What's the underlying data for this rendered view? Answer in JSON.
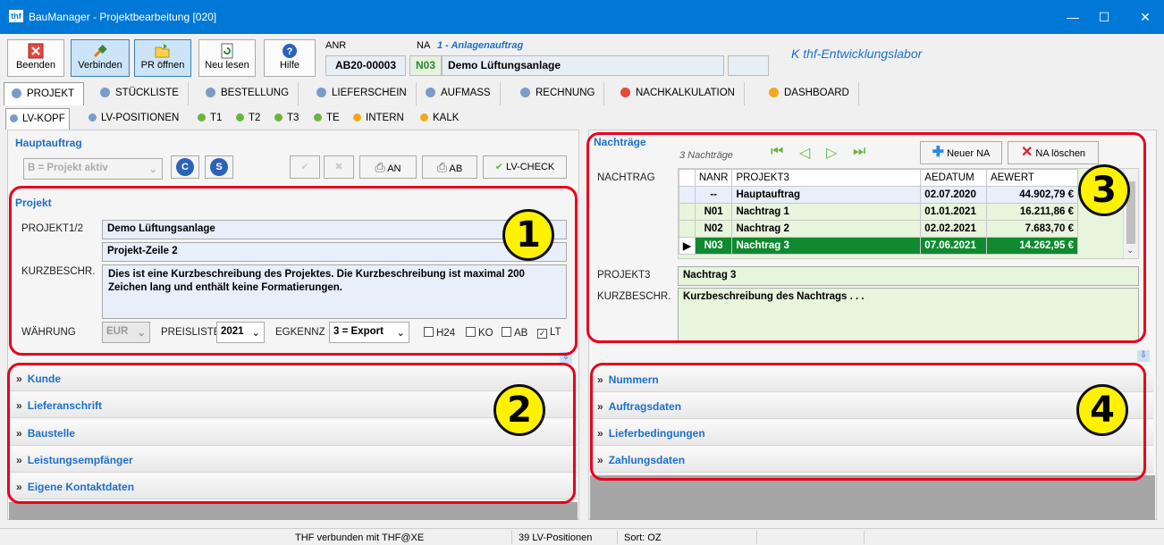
{
  "window": {
    "title": "BauManager - Projektbearbeitung [020]",
    "logo_text": "thf"
  },
  "toolbar": {
    "buttons": [
      {
        "label": "Beenden",
        "icon": "close-box-icon"
      },
      {
        "label": "Verbinden",
        "icon": "plug-icon"
      },
      {
        "label": "PR öffnen",
        "icon": "folder-open-icon"
      },
      {
        "label": "Neu lesen",
        "icon": "refresh-doc-icon"
      },
      {
        "label": "Hilfe",
        "icon": "help-icon"
      }
    ],
    "anr_label": "ANR",
    "anr_value": "AB20-00003",
    "na_label": "NA",
    "na_title": "1 - Anlagenauftrag",
    "na_code": "N03",
    "na_name": "Demo Lüftungsanlage",
    "company": "K thf-Entwicklungslabor"
  },
  "main_tabs": [
    {
      "label": "PROJEKT",
      "color": "#7a9cc8"
    },
    {
      "label": "STÜCKLISTE",
      "color": "#7a9cc8"
    },
    {
      "label": "BESTELLUNG",
      "color": "#7a9cc8"
    },
    {
      "label": "LIEFERSCHEIN",
      "color": "#7a9cc8"
    },
    {
      "label": "AUFMASS",
      "color": "#7a9cc8"
    },
    {
      "label": "RECHNUNG",
      "color": "#7a9cc8"
    },
    {
      "label": "NACHKALKULATION",
      "color": "#e24a3b"
    },
    {
      "label": "DASHBOARD",
      "color": "#f2a91d"
    }
  ],
  "sub_tabs": [
    {
      "label": "LV-KOPF",
      "color": "#7a9cc8"
    },
    {
      "label": "LV-POSITIONEN",
      "color": "#7a9cc8"
    },
    {
      "label": "T1",
      "color": "#6db33f"
    },
    {
      "label": "T2",
      "color": "#6db33f"
    },
    {
      "label": "T3",
      "color": "#6db33f"
    },
    {
      "label": "TE",
      "color": "#6db33f"
    },
    {
      "label": "INTERN",
      "color": "#f2a91d"
    },
    {
      "label": "KALK",
      "color": "#f2a91d"
    }
  ],
  "hauptauftrag": {
    "title": "Hauptauftrag",
    "status": "B = Projekt aktiv",
    "btn_c": "C",
    "btn_s": "S",
    "btn_an": "AN",
    "btn_ab": "AB",
    "btn_lvcheck": "LV-CHECK"
  },
  "projekt": {
    "title": "Projekt",
    "projekt12_label": "PROJEKT1/2",
    "projekt1": "Demo Lüftungsanlage",
    "projekt2": "Projekt-Zeile 2",
    "kurzbeschr_label": "KURZBESCHR.",
    "kurzbeschr": "Dies ist eine Kurzbeschreibung des Projektes. Die Kurzbeschreibung ist maximal 200 Zeichen lang und enthält keine Formatierungen.",
    "waehrung_label": "WÄHRUNG",
    "waehrung": "EUR",
    "preisliste_label": "PREISLISTE",
    "preisliste": "2021",
    "egkennz_label": "EGKENNZ",
    "egkennz": "3 = Export",
    "checks": [
      {
        "label": "H24",
        "checked": false
      },
      {
        "label": "KO",
        "checked": false
      },
      {
        "label": "AB",
        "checked": false
      },
      {
        "label": "LT",
        "checked": true
      }
    ]
  },
  "left_accordion": [
    "Kunde",
    "Lieferanschrift",
    "Baustelle",
    "Leistungsempfänger",
    "Eigene Kontaktdaten"
  ],
  "nachtraege": {
    "title": "Nachträge",
    "count_text": "3 Nachträge",
    "btn_new": "Neuer NA",
    "btn_delete": "NA löschen",
    "nachtrag_label": "NACHTRAG",
    "columns": [
      "NANR",
      "PROJEKT3",
      "AEDATUM",
      "AEWERT"
    ],
    "rows": [
      {
        "nanr": "--",
        "projekt": "Hauptauftrag",
        "datum": "02.07.2020",
        "wert": "44.902,79 €"
      },
      {
        "nanr": "N01",
        "projekt": "Nachtrag 1",
        "datum": "01.01.2021",
        "wert": "16.211,86 €"
      },
      {
        "nanr": "N02",
        "projekt": "Nachtrag 2",
        "datum": "02.02.2021",
        "wert": "7.683,70 €"
      },
      {
        "nanr": "N03",
        "projekt": "Nachtrag 3",
        "datum": "07.06.2021",
        "wert": "14.262,95 €"
      }
    ],
    "projekt3_label": "PROJEKT3",
    "projekt3": "Nachtrag 3",
    "kurzbeschr_label": "KURZBESCHR.",
    "kurzbeschr": "Kurzbeschreibung des Nachtrags . . ."
  },
  "right_accordion": [
    "Nummern",
    "Auftragsdaten",
    "Lieferbedingungen",
    "Zahlungsdaten"
  ],
  "callouts": [
    "1",
    "2",
    "3",
    "4"
  ],
  "status": {
    "connection": "THF verbunden mit THF@XE",
    "positions": "39 LV-Positionen",
    "sort": "Sort: OZ"
  }
}
